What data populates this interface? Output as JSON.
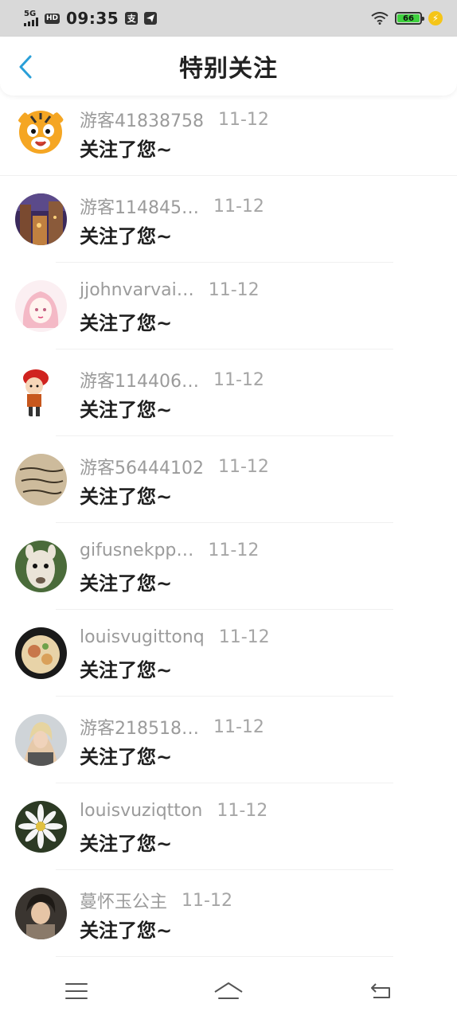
{
  "status_bar": {
    "network": "5G",
    "hd": "HD",
    "time": "09:35",
    "app_icon_1": "支",
    "battery": "66",
    "icons": [
      "signal-icon",
      "wifi-icon",
      "battery-icon",
      "charging-icon"
    ]
  },
  "header": {
    "title": "特别关注",
    "back_icon": "chevron-left-icon"
  },
  "items": [
    {
      "name": "游客41838758",
      "date": "11-12",
      "message": "关注了您~"
    },
    {
      "name": "游客114845…",
      "date": "11-12",
      "message": "关注了您~"
    },
    {
      "name": "jjohnvarvai…",
      "date": "11-12",
      "message": "关注了您~"
    },
    {
      "name": "游客114406…",
      "date": "11-12",
      "message": "关注了您~"
    },
    {
      "name": "游客56444102",
      "date": "11-12",
      "message": "关注了您~"
    },
    {
      "name": "gifusnekpp…",
      "date": "11-12",
      "message": "关注了您~"
    },
    {
      "name": "louisvugittonq",
      "date": "11-12",
      "message": "关注了您~"
    },
    {
      "name": "游客218518…",
      "date": "11-12",
      "message": "关注了您~"
    },
    {
      "name": "louisvuziqtton",
      "date": "11-12",
      "message": "关注了您~"
    },
    {
      "name": "蔓怀玉公主",
      "date": "11-12",
      "message": "关注了您~"
    }
  ],
  "bottom_nav": [
    "menu-icon",
    "home-icon",
    "back-icon"
  ],
  "colors": {
    "accent": "#2a9fd8",
    "status_bar_bg": "#d9d9d9",
    "battery": "#3fd13f"
  }
}
